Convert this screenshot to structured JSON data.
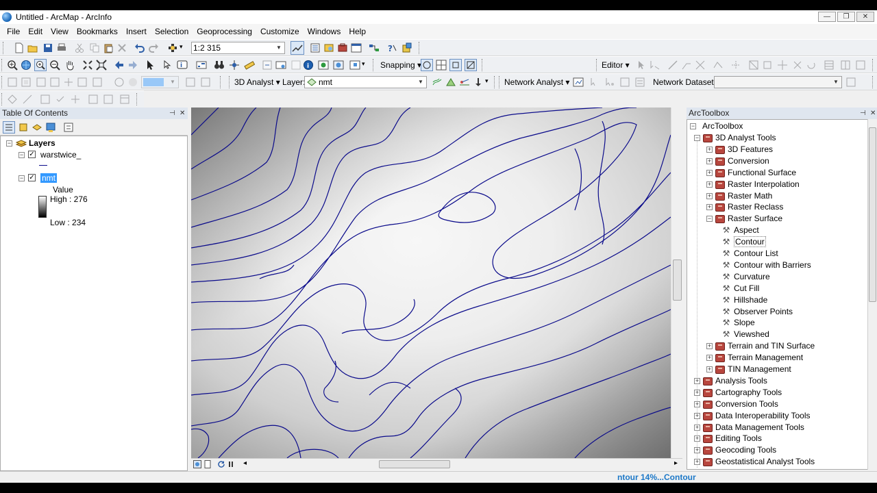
{
  "window": {
    "title": "Untitled - ArcMap - ArcInfo",
    "controls": [
      "—",
      "❐",
      "✕"
    ]
  },
  "menu": [
    "File",
    "Edit",
    "View",
    "Bookmarks",
    "Insert",
    "Selection",
    "Geoprocessing",
    "Customize",
    "Windows",
    "Help"
  ],
  "toolbar1": {
    "scale": "1:2 315"
  },
  "toolbar2": {
    "snapping": "Snapping ▾",
    "editor": "Editor ▾"
  },
  "toolbar3": {
    "analyst3d": "3D Analyst ▾",
    "layer_label": "Layer:",
    "layer_value": "nmt",
    "network_analyst": "Network Analyst ▾",
    "network_dataset": "Network Dataset:"
  },
  "toc": {
    "title": "Table Of Contents",
    "root": "Layers",
    "layer1": {
      "name": "warstwice_",
      "checked": "✓"
    },
    "layer2": {
      "name": "nmt",
      "checked": "✓",
      "legend_title": "Value",
      "high": "High : 276",
      "low": "Low : 234"
    }
  },
  "toolbox": {
    "title": "ArcToolbox",
    "root": "ArcToolbox",
    "items": [
      {
        "label": "3D Analyst Tools",
        "level": 0,
        "kind": "toolbox",
        "expander": "−"
      },
      {
        "label": "3D Features",
        "level": 1,
        "kind": "toolset",
        "expander": "+"
      },
      {
        "label": "Conversion",
        "level": 1,
        "kind": "toolset",
        "expander": "+"
      },
      {
        "label": "Functional Surface",
        "level": 1,
        "kind": "toolset",
        "expander": "+"
      },
      {
        "label": "Raster Interpolation",
        "level": 1,
        "kind": "toolset",
        "expander": "+"
      },
      {
        "label": "Raster Math",
        "level": 1,
        "kind": "toolset",
        "expander": "+"
      },
      {
        "label": "Raster Reclass",
        "level": 1,
        "kind": "toolset",
        "expander": "+"
      },
      {
        "label": "Raster Surface",
        "level": 1,
        "kind": "toolset",
        "expander": "−"
      },
      {
        "label": "Aspect",
        "level": 2,
        "kind": "tool"
      },
      {
        "label": "Contour",
        "level": 2,
        "kind": "tool",
        "selected": true
      },
      {
        "label": "Contour List",
        "level": 2,
        "kind": "tool"
      },
      {
        "label": "Contour with Barriers",
        "level": 2,
        "kind": "tool"
      },
      {
        "label": "Curvature",
        "level": 2,
        "kind": "tool"
      },
      {
        "label": "Cut Fill",
        "level": 2,
        "kind": "tool"
      },
      {
        "label": "Hillshade",
        "level": 2,
        "kind": "tool"
      },
      {
        "label": "Observer Points",
        "level": 2,
        "kind": "tool"
      },
      {
        "label": "Slope",
        "level": 2,
        "kind": "tool"
      },
      {
        "label": "Viewshed",
        "level": 2,
        "kind": "tool"
      },
      {
        "label": "Terrain and TIN Surface",
        "level": 1,
        "kind": "toolset",
        "expander": "+"
      },
      {
        "label": "Terrain Management",
        "level": 1,
        "kind": "toolset",
        "expander": "+"
      },
      {
        "label": "TIN Management",
        "level": 1,
        "kind": "toolset",
        "expander": "+"
      },
      {
        "label": "Analysis Tools",
        "level": 0,
        "kind": "toolbox",
        "expander": "+"
      },
      {
        "label": "Cartography Tools",
        "level": 0,
        "kind": "toolbox",
        "expander": "+"
      },
      {
        "label": "Conversion Tools",
        "level": 0,
        "kind": "toolbox",
        "expander": "+"
      },
      {
        "label": "Data Interoperability Tools",
        "level": 0,
        "kind": "toolbox",
        "expander": "+"
      },
      {
        "label": "Data Management Tools",
        "level": 0,
        "kind": "toolbox",
        "expander": "+"
      },
      {
        "label": "Editing Tools",
        "level": 0,
        "kind": "toolbox",
        "expander": "+"
      },
      {
        "label": "Geocoding Tools",
        "level": 0,
        "kind": "toolbox",
        "expander": "+"
      },
      {
        "label": "Geostatistical Analyst Tools",
        "level": 0,
        "kind": "toolbox",
        "expander": "+"
      }
    ]
  },
  "status": {
    "text": "ntour 14%...Contour"
  },
  "colors": {
    "contour": "#0a0a8a",
    "selection": "#3399ff",
    "toolbox_icon": "#b8463e",
    "status_text": "#1c78c8"
  }
}
